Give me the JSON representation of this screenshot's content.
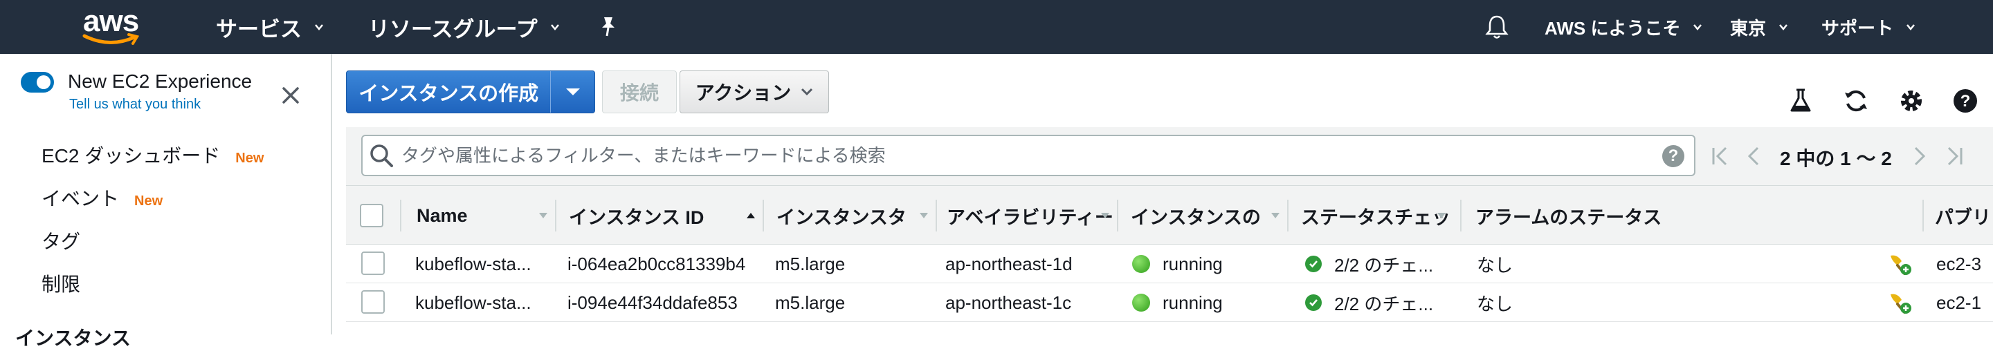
{
  "topnav": {
    "logo": "aws",
    "services": "サービス",
    "resource_groups": "リソースグループ",
    "bell_icon": "bell-icon",
    "account": "AWS にようこそ",
    "region": "東京",
    "support": "サポート"
  },
  "sidebar": {
    "experience_title": "New EC2 Experience",
    "experience_link": "Tell us what you think",
    "items": [
      {
        "label": "EC2 ダッシュボード",
        "badge": "New"
      },
      {
        "label": "イベント",
        "badge": "New"
      },
      {
        "label": "タグ",
        "badge": ""
      },
      {
        "label": "制限",
        "badge": ""
      }
    ],
    "section": "インスタンス"
  },
  "toolbar": {
    "create_label": "インスタンスの作成",
    "connect_label": "接続",
    "actions_label": "アクション"
  },
  "filter": {
    "placeholder": "タグや属性によるフィルター、またはキーワードによる検索",
    "help": "?",
    "pager_text": "2 中の 1 〜 2"
  },
  "table": {
    "headers": [
      "Name",
      "インスタンス ID",
      "インスタンスタ",
      "アベイラビリティー",
      "インスタンスの",
      "ステータスチェッ",
      "アラームのステータス",
      "パブリ"
    ],
    "rows": [
      {
        "name": "kubeflow-sta...",
        "id": "i-064ea2b0cc81339b4",
        "type": "m5.large",
        "az": "ap-northeast-1d",
        "state": "running",
        "checks": "2/2 のチェ...",
        "alarm": "なし",
        "public": "ec2-3"
      },
      {
        "name": "kubeflow-sta...",
        "id": "i-094e44f34ddafe853",
        "type": "m5.large",
        "az": "ap-northeast-1c",
        "state": "running",
        "checks": "2/2 のチェ...",
        "alarm": "なし",
        "public": "ec2-1"
      }
    ]
  },
  "colors": {
    "nav_bg": "#232f3e",
    "primary": "#1f64be",
    "link": "#0073bb",
    "badge_new": "#ec7211",
    "running": "#2f9e1a"
  }
}
